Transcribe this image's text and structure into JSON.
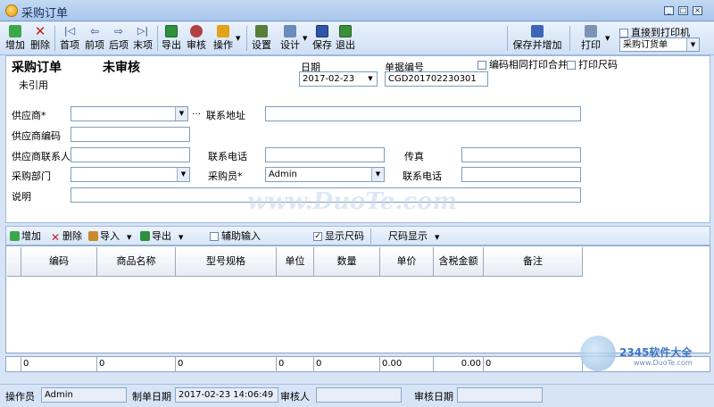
{
  "window": {
    "title": "采购订单"
  },
  "toolbar": {
    "add": "增加",
    "delete": "删除",
    "first": "首项",
    "prev": "前项",
    "next": "后项",
    "last": "末项",
    "export": "导出",
    "audit": "审核",
    "operate": "操作",
    "settings": "设置",
    "design": "设计",
    "save": "保存",
    "exit": "退出",
    "save_and_add": "保存并增加",
    "print": "打印",
    "direct_print_label": "直接到打印机",
    "print_template_value": "采购订货单"
  },
  "header": {
    "form_title": "采购订单",
    "status": "未审核",
    "ref_status": "未引用",
    "date_label": "日期",
    "date_value": "2017-02-23",
    "doc_no_label": "单据编号",
    "doc_no_value": "CGD201702230301",
    "merge_print_label": "编码相同打印合并",
    "print_size_label": "打印尺码"
  },
  "fields": {
    "supplier_label": "供应商*",
    "supplier_value": "",
    "address_label": "联系地址",
    "address_value": "",
    "supplier_code_label": "供应商编码",
    "supplier_code_value": "",
    "contact_label": "供应商联系人",
    "contact_value": "",
    "phone_label": "联系电话",
    "phone_value": "",
    "fax_label": "传真",
    "fax_value": "",
    "dept_label": "采购部门",
    "dept_value": "",
    "buyer_label": "采购员*",
    "buyer_value": "Admin",
    "phone2_label": "联系电话",
    "phone2_value": "",
    "note_label": "说明",
    "note_value": ""
  },
  "detail_toolbar": {
    "add": "增加",
    "delete": "删除",
    "import": "导入",
    "export": "导出",
    "aux_input": "辅助输入",
    "show_size": "显示尺码",
    "size_display": "尺码显示"
  },
  "grid": {
    "columns": [
      "编码",
      "商品名称",
      "型号规格",
      "单位",
      "数量",
      "单价",
      "含税金额",
      "备注"
    ],
    "totals": [
      "0",
      "0",
      "0",
      "0",
      "0",
      "0.00",
      "0.00",
      "0"
    ]
  },
  "statusbar": {
    "operator_label": "操作员",
    "operator_value": "Admin",
    "created_label": "制单日期",
    "created_value": "2017-02-23 14:06:49",
    "auditor_label": "审核人",
    "auditor_value": "",
    "audit_date_label": "审核日期",
    "audit_date_value": ""
  },
  "watermark": {
    "text": "www.DuoTe.com",
    "corner_text": "2345软件大全",
    "corner_url": "www.DuoTe.com"
  },
  "colors": {
    "accent": "#1b2f55",
    "selection": "#316ac5",
    "background": "#d6e4f5"
  }
}
